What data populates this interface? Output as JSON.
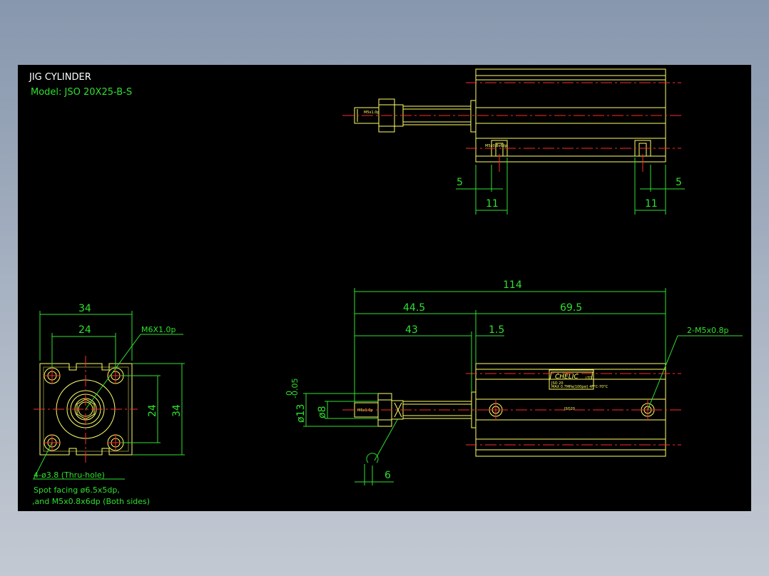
{
  "title": {
    "name": "JIG CYLINDER",
    "model": "Model:  JSO 20X25-B-S"
  },
  "colors": {
    "background": "#000000",
    "outline": "#ffff66",
    "dimension": "#2fe02f",
    "centerline": "#ff2a2a"
  },
  "top_view": {
    "thread_label": "M5x1.0p",
    "port_label": "M5x0.8x6dp",
    "dim_left_5": "5",
    "dim_left_11": "11",
    "dim_right_5": "5",
    "dim_right_11": "11"
  },
  "end_view": {
    "width_outer": "34",
    "width_inner": "24",
    "height_inner": "24",
    "height_outer": "34",
    "thread_callout": "M6X1.0p",
    "hole_note": "4-ø3.8 (Thru-hole)",
    "spot_note": "Spot facing ø6.5x5dp,",
    "thread_note": ",and M5x0.8x6dp (Both sides)"
  },
  "side_view": {
    "overall": "114",
    "left_part": "44.5",
    "right_part": "69.5",
    "rod_length": "43",
    "flange": "1.5",
    "port_callout": "2-M5x0.8p",
    "rod_dia": "ø8",
    "bore_dia": "ø13",
    "tol_upper": "0",
    "tol_lower": "-0.05",
    "wrench": "6",
    "brand": "CHELIC",
    "brand_suffix": "LTD",
    "rod_thread": "M6x1.0p",
    "plate_line1": "JSO 20",
    "plate_line2": "MAX 0.7MPa(100psi) 4F°C-70°C",
    "body_mark": "JSO20"
  }
}
